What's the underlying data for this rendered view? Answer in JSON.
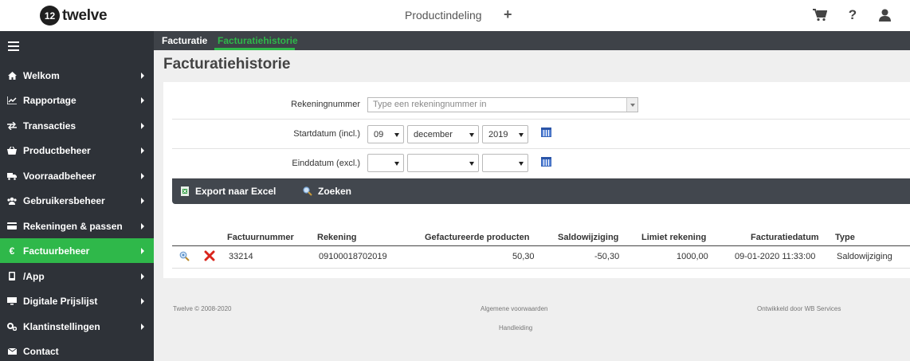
{
  "header": {
    "logo_badge": "12",
    "logo_text": "twelve",
    "center_title": "Productindeling",
    "add_icon": "plus-icon",
    "icons": [
      "cart-icon",
      "help-icon",
      "user-icon"
    ]
  },
  "sidebar": {
    "items": [
      {
        "label": "Welkom",
        "icon": "home-icon"
      },
      {
        "label": "Rapportage",
        "icon": "chart-icon"
      },
      {
        "label": "Transacties",
        "icon": "transfer-icon"
      },
      {
        "label": "Productbeheer",
        "icon": "basket-icon"
      },
      {
        "label": "Voorraadbeheer",
        "icon": "truck-icon"
      },
      {
        "label": "Gebruikersbeheer",
        "icon": "users-icon"
      },
      {
        "label": "Rekeningen & passen",
        "icon": "card-icon"
      },
      {
        "label": "Factuurbeheer",
        "icon": "euro-icon",
        "active": true
      },
      {
        "label": "/App",
        "icon": "mobile-icon"
      },
      {
        "label": "Digitale Prijslijst",
        "icon": "monitor-icon"
      },
      {
        "label": "Klantinstellingen",
        "icon": "cogs-icon"
      },
      {
        "label": "Contact",
        "icon": "envelope-icon"
      }
    ]
  },
  "tabs": [
    "Facturatie",
    "Facturatiehistorie"
  ],
  "page_title": "Facturatiehistorie",
  "form": {
    "account_label": "Rekeningnummer",
    "account_placeholder": "Type een rekeningnummer in",
    "start_label": "Startdatum",
    "start_suffix": "(incl.)",
    "start_day": "09",
    "start_month": "december",
    "start_year": "2019",
    "end_label": "Einddatum",
    "end_suffix": "(excl.)",
    "end_day": "",
    "end_month": "",
    "end_year": ""
  },
  "toolbar": {
    "export_label": "Export naar Excel",
    "search_label": "Zoeken"
  },
  "table": {
    "columns": [
      "Factuurnummer",
      "Rekening",
      "Gefactureerde producten",
      "Saldowijziging",
      "Limiet rekening",
      "Facturatiedatum",
      "Type"
    ],
    "rows": [
      {
        "factuurnummer": "33214",
        "rekening": "09100018702019",
        "gefactureerde_producten": "50,30",
        "saldowijziging": "-50,30",
        "limiet_rekening": "1000,00",
        "facturatiedatum": "09-01-2020 11:33:00",
        "type": "Saldowijziging"
      }
    ]
  },
  "footer": {
    "copyright": "Twelve © 2008-2020",
    "terms": "Algemene voorwaarden",
    "manual": "Handleiding",
    "developed_by": "Ontwikkeld door WB Services"
  },
  "colors": {
    "accent_green": "#2fb84a",
    "sidebar_bg": "#2e3238",
    "toolbar_bg": "#42474e"
  }
}
